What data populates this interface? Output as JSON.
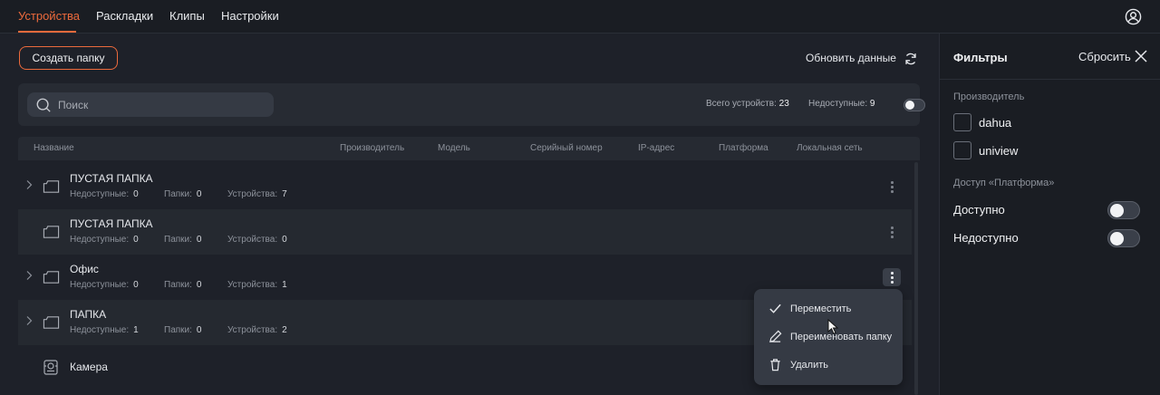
{
  "colors": {
    "accent": "#ec6a3c",
    "background": "#1e2129",
    "panel": "#272b33",
    "menu": "#353a44"
  },
  "nav": {
    "tabs": [
      {
        "label": "Устройства",
        "active": true
      },
      {
        "label": "Раскладки",
        "active": false
      },
      {
        "label": "Клипы",
        "active": false
      },
      {
        "label": "Настройки",
        "active": false
      }
    ],
    "user_icon": "user-circle-icon"
  },
  "toolbar": {
    "create_folder_label": "Создать папку",
    "refresh_label": "Обновить данные",
    "refresh_icon": "refresh-icon"
  },
  "search": {
    "placeholder": "Поиск",
    "total_label": "Всего устройств:",
    "total_value": "23",
    "unavailable_label": "Недоступные:",
    "unavailable_value": "9",
    "unavailable_toggle_on": false
  },
  "table": {
    "columns": [
      "Название",
      "Производитель",
      "Модель",
      "Серийный номер",
      "IP-адрес",
      "Платформа",
      "Локальная сеть"
    ],
    "meta_labels": {
      "unavailable": "Недоступные:",
      "folders": "Папки:",
      "devices": "Устройства:"
    },
    "rows": [
      {
        "type": "folder",
        "title": "ПУСТАЯ ПАПКА",
        "unavailable": "0",
        "folders": "0",
        "devices": "7"
      },
      {
        "type": "folder",
        "title": "ПУСТАЯ ПАПКА",
        "unavailable": "0",
        "folders": "0",
        "devices": "0"
      },
      {
        "type": "folder",
        "title": "Офис",
        "unavailable": "0",
        "folders": "0",
        "devices": "1"
      },
      {
        "type": "folder",
        "title": "ПАПКА",
        "unavailable": "1",
        "folders": "0",
        "devices": "2"
      },
      {
        "type": "camera",
        "title": "Камера"
      }
    ]
  },
  "context_menu": {
    "items": [
      {
        "label": "Переместить",
        "icon": "check-icon"
      },
      {
        "label": "Переименовать папку",
        "icon": "pencil-icon"
      },
      {
        "label": "Удалить",
        "icon": "trash-icon"
      }
    ]
  },
  "filters": {
    "title": "Фильтры",
    "reset_label": "Сбросить",
    "manufacturer_section": "Производитель",
    "manufacturers": [
      {
        "label": "dahua",
        "checked": false
      },
      {
        "label": "uniview",
        "checked": false
      }
    ],
    "access_section": "Доступ «Платформа»",
    "access": [
      {
        "label": "Доступно",
        "on": false
      },
      {
        "label": "Недоступно",
        "on": false
      }
    ]
  }
}
